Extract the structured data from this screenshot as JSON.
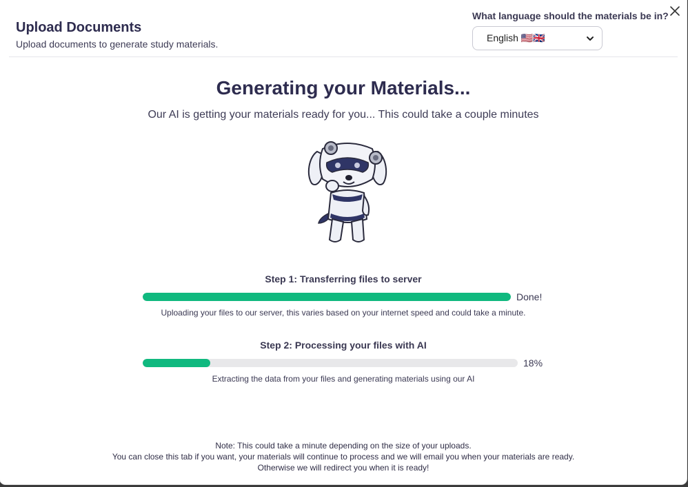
{
  "header": {
    "title": "Upload Documents",
    "subtitle": "Upload documents to generate study materials.",
    "language_label": "What language should the materials be in?",
    "language_selected": "English 🇺🇸🇬🇧",
    "close_icon": "close-icon"
  },
  "main": {
    "heading": "Generating your Materials...",
    "lead": "Our AI is getting your materials ready for you... This could take a couple minutes",
    "mascot_icon": "robot-dog-mascot"
  },
  "steps": [
    {
      "title": "Step 1: Transferring files to server",
      "status": "Done!",
      "progress": 1.0,
      "description": "Uploading your files to our server, this varies based on your internet speed and could take a minute."
    },
    {
      "title": "Step 2: Processing your files with AI",
      "status": "18%",
      "progress": 0.18,
      "description": "Extracting the data from your files and generating materials using our AI"
    }
  ],
  "note": {
    "line1": "Note: This could take a minute depending on the size of your uploads.",
    "line2": "You can close this tab if you want, your materials will continue to process and we will email you when your materials are ready.",
    "line3": "Otherwise we will redirect you when it is ready!"
  },
  "colors": {
    "accent": "#10b97f",
    "track": "#e8e8ea",
    "title": "#2e2c4f"
  }
}
